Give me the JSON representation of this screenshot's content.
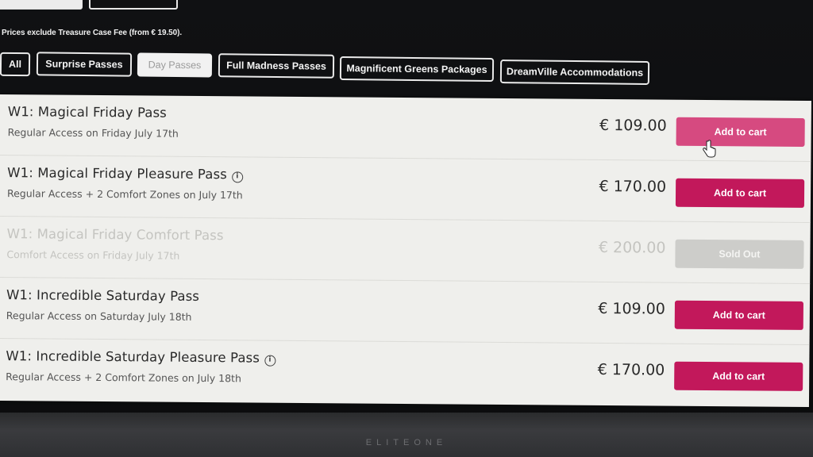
{
  "fee_note": "Prices exclude Treasure Case Fee (from € 19.50).",
  "filters": [
    {
      "label": "All",
      "active": false
    },
    {
      "label": "Surprise Passes",
      "active": false
    },
    {
      "label": "Day Passes",
      "active": true
    },
    {
      "label": "Full Madness Passes",
      "active": false
    },
    {
      "label": "Magnificent Greens Packages",
      "active": false
    },
    {
      "label": "DreamVille Accommodations",
      "active": false
    }
  ],
  "products": [
    {
      "title": "W1: Magical Friday Pass",
      "subtitle": "Regular Access on Friday July 17th",
      "price": "€ 109.00",
      "action": "Add to cart",
      "info": false,
      "sold_out": false
    },
    {
      "title": "W1: Magical Friday Pleasure Pass",
      "subtitle": "Regular Access + 2 Comfort Zones on July 17th",
      "price": "€ 170.00",
      "action": "Add to cart",
      "info": true,
      "sold_out": false
    },
    {
      "title": "W1: Magical Friday Comfort Pass",
      "subtitle": "Comfort Access on Friday July 17th",
      "price": "€ 200.00",
      "action": "Sold Out",
      "info": false,
      "sold_out": true
    },
    {
      "title": "W1: Incredible Saturday Pass",
      "subtitle": "Regular Access on Saturday July 18th",
      "price": "€ 109.00",
      "action": "Add to cart",
      "info": false,
      "sold_out": false
    },
    {
      "title": "W1: Incredible Saturday Pleasure Pass",
      "subtitle": "Regular Access + 2 Comfort Zones on July 18th",
      "price": "€ 170.00",
      "action": "Add to cart",
      "info": true,
      "sold_out": false
    }
  ],
  "bezel_brand": "ELITEONE",
  "colors": {
    "accent": "#c2185b",
    "accent_hover": "#d64a80",
    "sold_out": "#cdcdca"
  },
  "icons": {
    "info": "info-circle-icon",
    "cursor": "hand-pointer-icon"
  }
}
